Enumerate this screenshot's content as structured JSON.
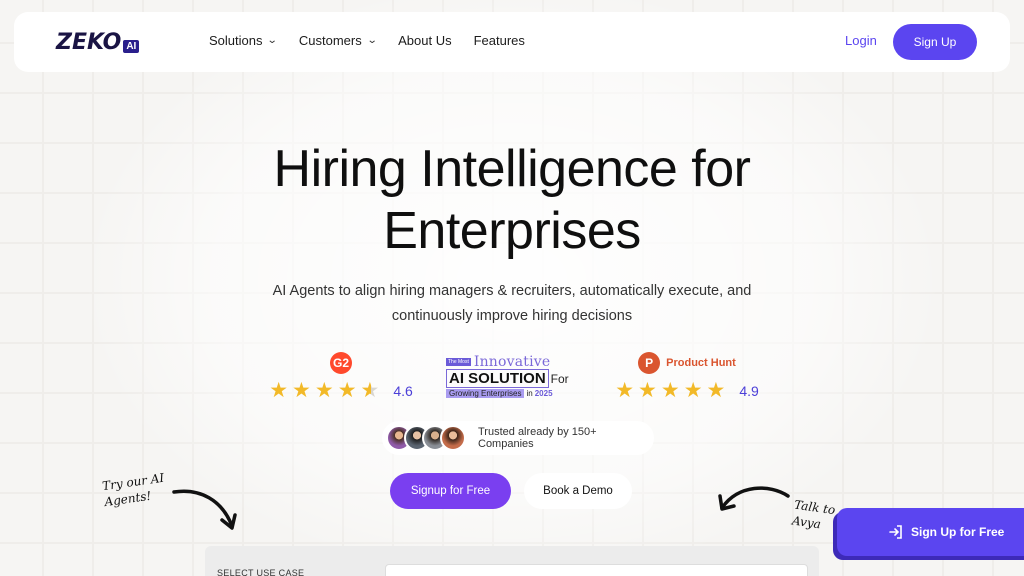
{
  "brand": {
    "logo_text": "ZEKO",
    "logo_badge": "AI"
  },
  "nav": {
    "items": [
      {
        "label": "Solutions",
        "has_dropdown": true
      },
      {
        "label": "Customers",
        "has_dropdown": true
      },
      {
        "label": "About Us",
        "has_dropdown": false
      },
      {
        "label": "Features",
        "has_dropdown": false
      }
    ],
    "login_label": "Login",
    "signup_label": "Sign Up"
  },
  "hero": {
    "title_line1": "Hiring Intelligence for",
    "title_line2": "Enterprises",
    "subtitle_line1": "AI Agents to align hiring managers & recruiters, automatically execute, and",
    "subtitle_line2": "continuously improve hiring decisions"
  },
  "ratings": {
    "g2": {
      "logo": "G2",
      "score": "4.6",
      "stars": 4.6
    },
    "product_hunt": {
      "logo": "P",
      "name": "Product Hunt",
      "score": "4.9",
      "stars": 4.9
    }
  },
  "award": {
    "small": "The Most",
    "innovative": "Innovative",
    "main": "AI SOLUTION",
    "for": "For",
    "growing": "Growing Enterprises",
    "in": "in",
    "year": "2025"
  },
  "trusted": {
    "text": "Trusted already by 150+ Companies"
  },
  "cta": {
    "primary": "Signup for Free",
    "secondary": "Book a Demo"
  },
  "notes": {
    "left": "Try our AI Agents!",
    "right": "Talk to Avya"
  },
  "float_signup": {
    "label": "Sign  Up for Free",
    "icon": "sign-in-icon"
  },
  "use_case": {
    "label": "SELECT USE CASE"
  },
  "colors": {
    "accent": "#5b45f0",
    "cta_purple": "#7a3ff0",
    "star": "#f2b928"
  }
}
